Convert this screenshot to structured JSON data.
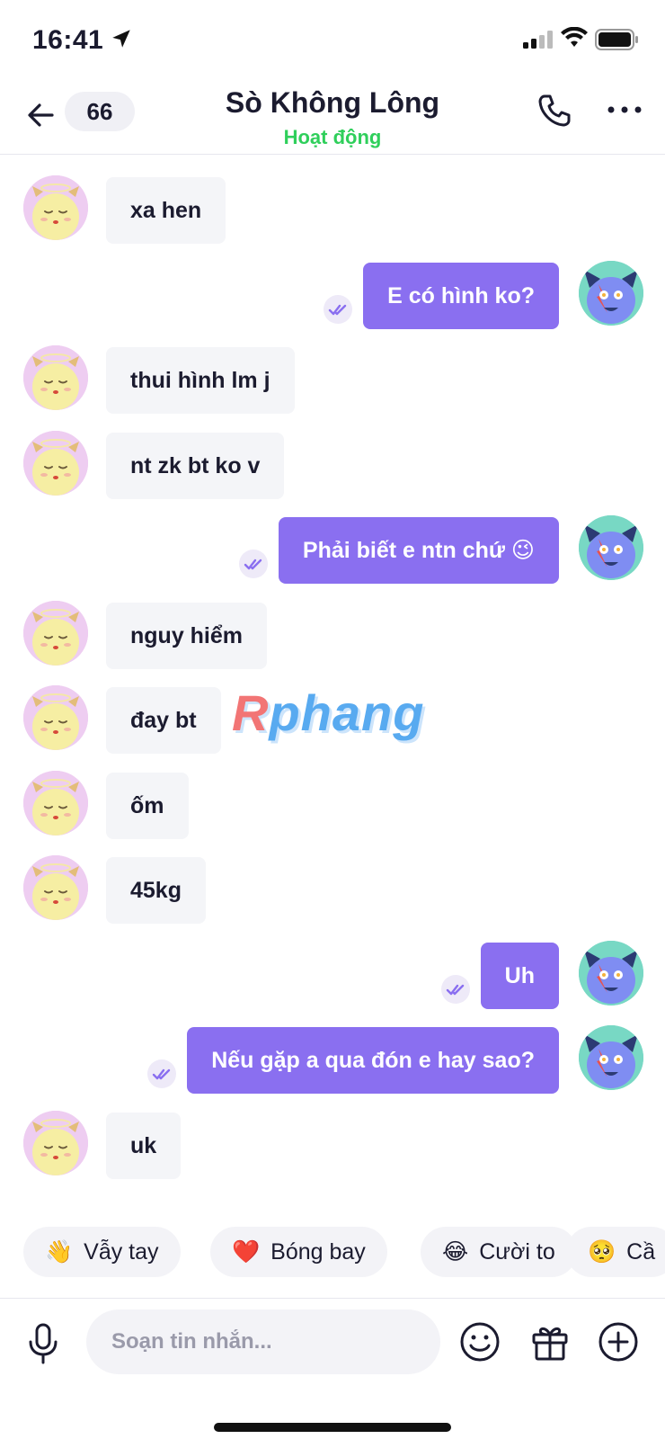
{
  "status_bar": {
    "time": "16:41"
  },
  "header": {
    "unread_count": "66",
    "contact_name": "Sò Không Lông",
    "contact_status": "Hoạt động"
  },
  "messages": [
    {
      "side": "in",
      "text": "xa hen"
    },
    {
      "side": "out",
      "text": "E có hình ko?"
    },
    {
      "side": "in",
      "text": "thui hình lm j"
    },
    {
      "side": "in",
      "text": "nt zk bt ko v"
    },
    {
      "side": "out",
      "text": "Phải biết e ntn chứ 😉"
    },
    {
      "side": "in",
      "text": "nguy hiểm"
    },
    {
      "side": "in",
      "text": "đay bt"
    },
    {
      "side": "in",
      "text": "ốm"
    },
    {
      "side": "in",
      "text": "45kg"
    },
    {
      "side": "out",
      "text": "Uh"
    },
    {
      "side": "out",
      "text": "Nếu gặp a qua đón e hay sao?"
    },
    {
      "side": "in",
      "text": "uk"
    }
  ],
  "watermark": {
    "first": "R",
    "rest": "phang"
  },
  "quick_reactions": [
    {
      "emoji": "👋",
      "label": "Vẫy tay"
    },
    {
      "emoji": "❤️",
      "label": "Bóng bay"
    },
    {
      "emoji": "😂",
      "label": "Cười to"
    },
    {
      "emoji": "🥺",
      "label": "Cầ"
    }
  ],
  "composer": {
    "placeholder": "Soạn tin nhắn..."
  },
  "colors": {
    "accent": "#8a6ff0",
    "online": "#2fcf5b",
    "incoming_bubble": "#f4f5f8"
  },
  "icons": [
    "location-arrow-icon",
    "signal-icon",
    "wifi-icon",
    "battery-icon",
    "back-arrow-icon",
    "phone-icon",
    "more-icon",
    "double-check-icon",
    "mic-icon",
    "emoji-icon",
    "gift-icon",
    "plus-icon"
  ]
}
